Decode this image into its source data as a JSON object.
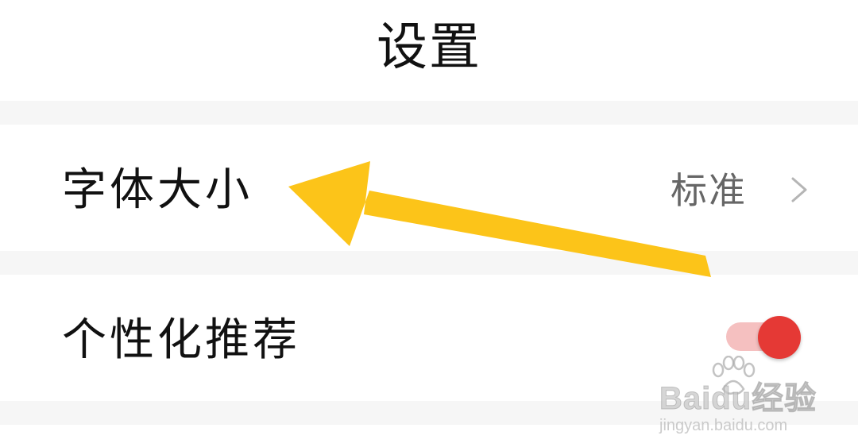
{
  "header": {
    "title": "设置"
  },
  "settings": {
    "font_size": {
      "label": "字体大小",
      "value": "标准"
    },
    "personalized_recommendation": {
      "label": "个性化推荐",
      "enabled": true
    }
  },
  "watermark": {
    "logo": "Baidu经验",
    "url": "jingyan.baidu.com"
  },
  "colors": {
    "toggle_on": "#e53935",
    "toggle_track": "#f5c0c0",
    "annotation_arrow": "#fcc419",
    "section_gap": "#f6f6f6"
  },
  "icons": {
    "chevron": "chevron-right-icon",
    "annotation": "arrow-annotation-icon"
  }
}
